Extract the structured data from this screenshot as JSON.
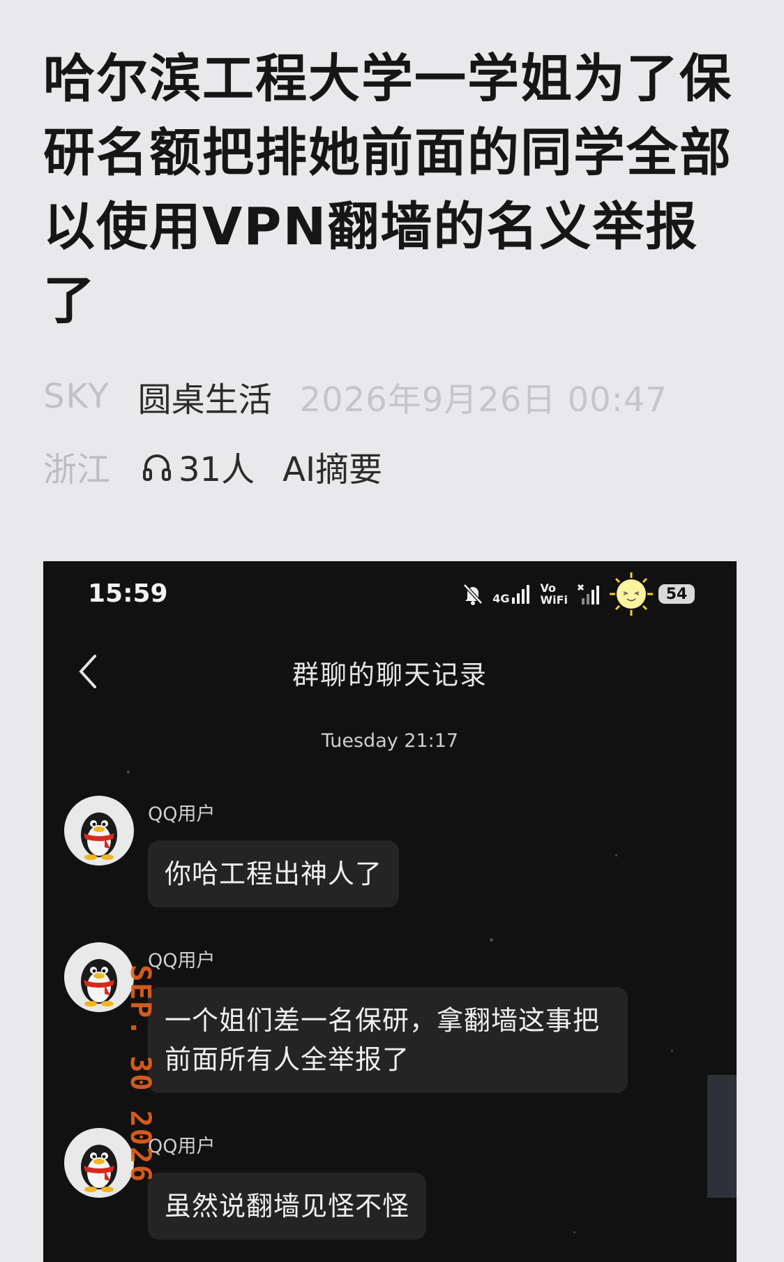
{
  "article": {
    "title": "哈尔滨工程大学一学姐为了保研名额把排她前面的同学全部以使用VPN翻墙的名义举报了",
    "author": "SKY",
    "channel": "圆桌生活",
    "date": "2026年9月26日 00:47",
    "region": "浙江",
    "listeners": "31人",
    "ai_summary": "AI摘要"
  },
  "phone": {
    "status_time": "15:59",
    "network_label": "4G",
    "vowifi_label": "Vo\nWiFi",
    "battery": "54",
    "nav_title": "群聊的聊天记录",
    "timestamp": "Tuesday 21:17",
    "date_stamp": "SEP. 30 2026",
    "messages": [
      {
        "sender": "QQ用户",
        "text": "你哈工程出神人了"
      },
      {
        "sender": "QQ用户",
        "text": "一个姐们差一名保研，拿翻墙这事把前面所有人全举报了"
      },
      {
        "sender": "QQ用户",
        "text": "虽然说翻墙见怪不怪"
      }
    ]
  },
  "colors": {
    "page_bg": "#e9e9eb",
    "title": "#161616",
    "meta_muted": "#b7b7bb",
    "chat_bg": "#111111",
    "bubble_bg": "#242424",
    "stamp_orange": "#e8621f"
  }
}
